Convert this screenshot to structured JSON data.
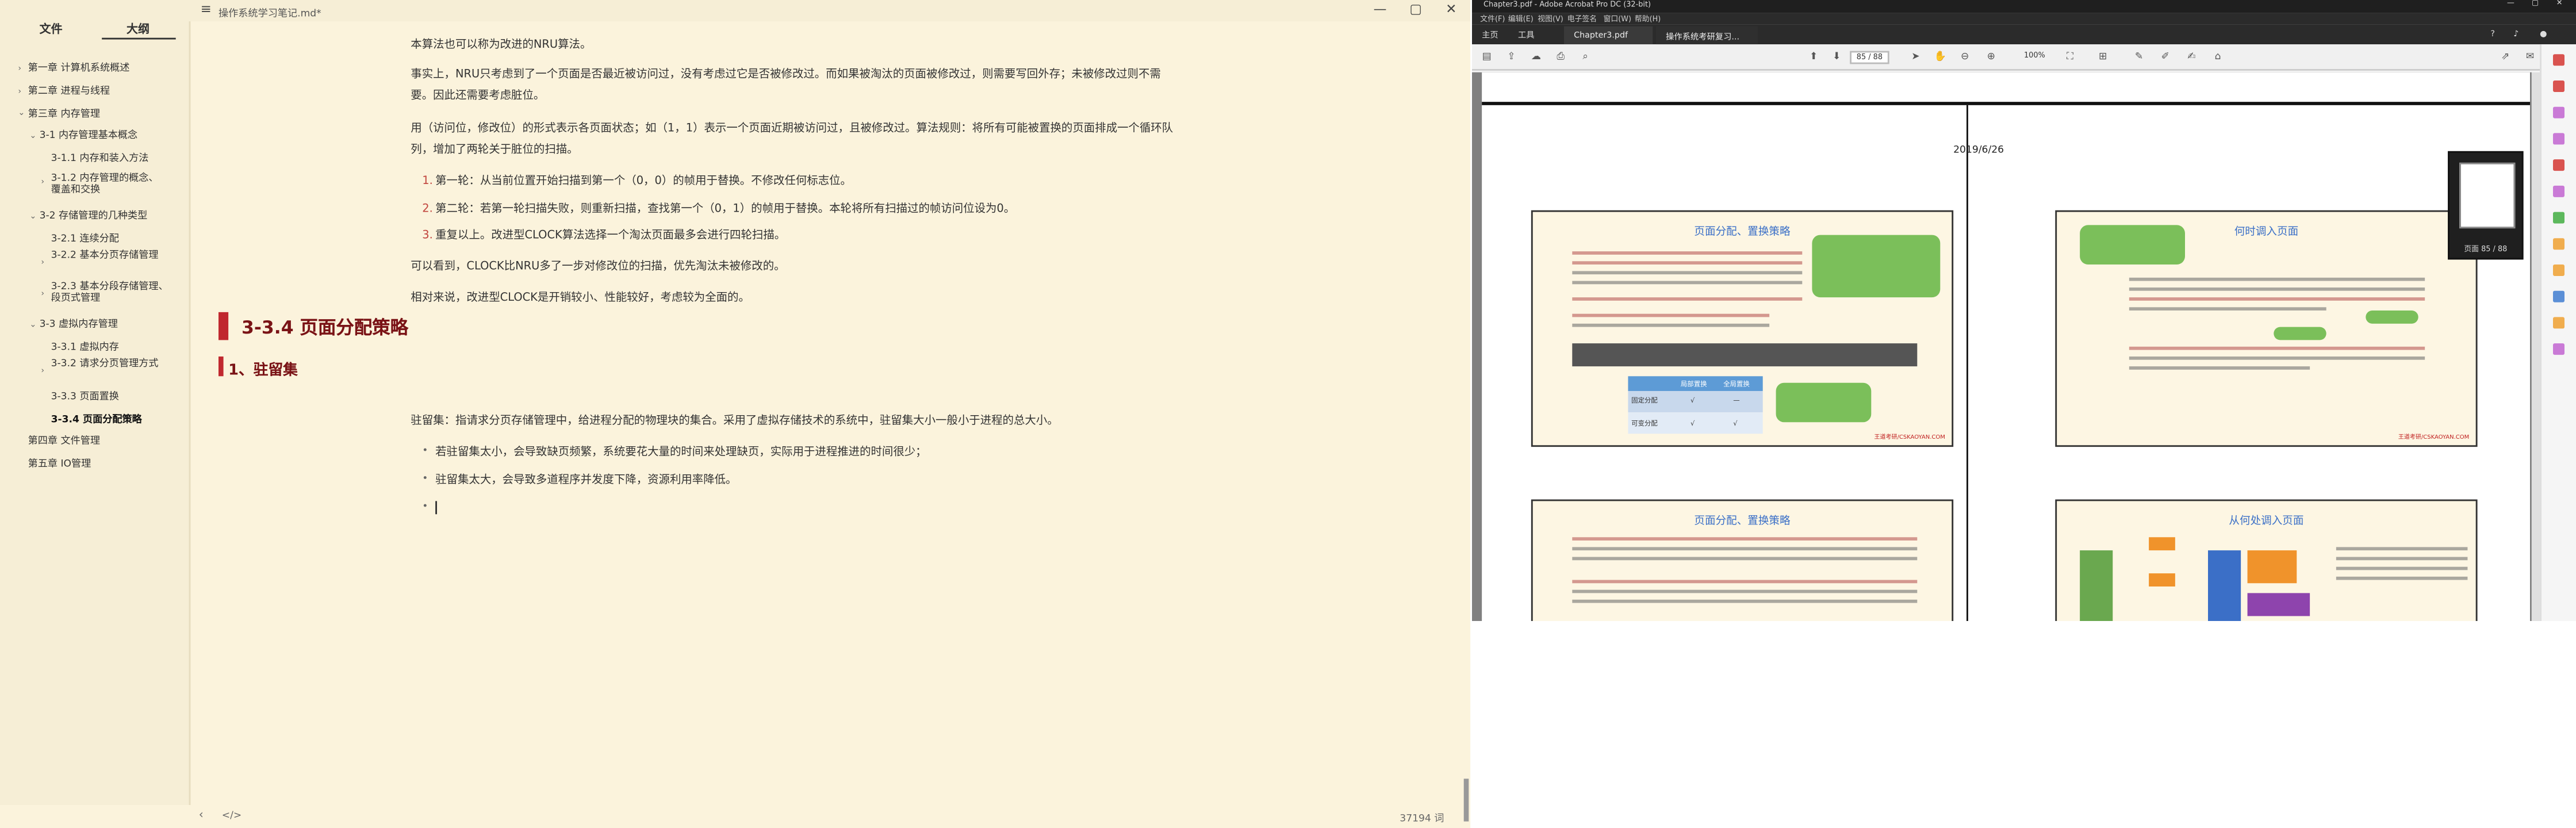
{
  "editor_window": {
    "title": "操作系统学习笔记.md*",
    "menu_icon": "hamburger-icon",
    "controls": {
      "minimize": "—",
      "maximize": "▢",
      "close": "✕"
    }
  },
  "sidebar": {
    "tabs": [
      "文件",
      "大纲"
    ],
    "active_tab": "大纲",
    "outline": [
      {
        "toggle": "›",
        "label": "第一章 计算机系统概述"
      },
      {
        "toggle": "›",
        "label": "第二章 进程与线程"
      },
      {
        "toggle": "⌄",
        "label": "第三章 内存管理"
      },
      {
        "toggle": "⌄",
        "label": "3-1 内存管理基本概念"
      },
      {
        "toggle": "",
        "label": "3-1.1 内存和装入方法"
      },
      {
        "toggle": "›",
        "label": "3-1.2 内存管理的概念、覆盖和交换"
      },
      {
        "toggle": "⌄",
        "label": "3-2 存储管理的几种类型"
      },
      {
        "toggle": "",
        "label": "3-2.1 连续分配"
      },
      {
        "toggle": "›",
        "label": "3-2.2 基本分页存储管理"
      },
      {
        "toggle": "›",
        "label": "3-2.3 基本分段存储管理、段页式管理"
      },
      {
        "toggle": "⌄",
        "label": "3-3 虚拟内存管理"
      },
      {
        "toggle": "",
        "label": "3-3.1 虚拟内存"
      },
      {
        "toggle": "›",
        "label": "3-3.2 请求分页管理方式"
      },
      {
        "toggle": "",
        "label": "3-3.3 页面置换"
      },
      {
        "toggle": "",
        "label": "3-3.4 页面分配策略"
      },
      {
        "toggle": "",
        "label": "第四章 文件管理"
      },
      {
        "toggle": "",
        "label": "第五章 IO管理"
      }
    ]
  },
  "content": {
    "p1": "本算法也可以称为改进的NRU算法。",
    "p2a": "事实上，NRU只考虑到了一个页面是否最近被访问过，没有考虑过它是否被修改过。而如果被淘汰的页面被修改过，则需要写回外存；未被修改过则不需",
    "p2b": "要。因此还需要考虑脏位。",
    "p3a": "用（访问位，修改位）的形式表示各页面状态；如（1，1）表示一个页面近期被访问过，且被修改过。算法规则：将所有可能被置换的页面排成一个循环队",
    "p3b": "列，增加了两轮关于脏位的扫描。",
    "steps": [
      {
        "num": "1.",
        "text": "第一轮：从当前位置开始扫描到第一个（0，0）的帧用于替换。不修改任何标志位。"
      },
      {
        "num": "2.",
        "text": "第二轮：若第一轮扫描失败，则重新扫描，查找第一个（0，1）的帧用于替换。本轮将所有扫描过的帧访问位设为0。"
      },
      {
        "num": "3.",
        "text": "重复以上。改进型CLOCK算法选择一个淘汰页面最多会进行四轮扫描。"
      }
    ],
    "p4": "可以看到，CLOCK比NRU多了一步对修改位的扫描，优先淘汰未被修改的。",
    "p5": "相对来说，改进型CLOCK是开销较小、性能较好，考虑较为全面的。",
    "heading2": "3-3.4 页面分配策略",
    "heading3": "1、驻留集",
    "p6": "驻留集：指请求分页存储管理中，给进程分配的物理块的集合。采用了虚拟存储技术的系统中，驻留集大小一般小于进程的总大小。",
    "bullets": [
      "若驻留集太小，会导致缺页频繁，系统要花大量的时间来处理缺页，实际用于进程推进的时间很少；",
      "驻留集太大，会导致多道程序并发度下降，资源利用率降低。",
      ""
    ]
  },
  "statusbar": {
    "left_icon": "chevron-left-icon",
    "code_icon": "</>",
    "word_count": "37194 词"
  },
  "acrobat": {
    "title": "Chapter3.pdf - Adobe Acrobat Pro DC (32-bit)",
    "menu": [
      "文件(F)",
      "编辑(E)",
      "视图(V)",
      "电子签名",
      "窗口(W)",
      "帮助(H)"
    ],
    "tabs": [
      "主页",
      "工具"
    ],
    "file_tabs": [
      "Chapter3.pdf",
      "操作系统考研复习..."
    ],
    "page_field": "85 / 88",
    "zoom": "100%",
    "pdf": {
      "date": "2019/6/26",
      "slides": [
        {
          "title": "页面分配、置换策略",
          "copyright": "王道考研/CSKAOYAN.COM",
          "table_header": [
            "局部置换",
            "全局置换"
          ],
          "table_rows": [
            [
              "固定分配",
              "√",
              "—"
            ],
            [
              "可变分配",
              "√",
              "√"
            ]
          ]
        },
        {
          "title": "何时调入页面",
          "copyright": "王道考研/CSKAOYAN.COM"
        },
        {
          "title": "页面分配、置换策略",
          "copyright": ""
        },
        {
          "title": "从何处调入页面",
          "copyright": ""
        }
      ]
    },
    "thumbnail_label": "页面 85 / 88"
  },
  "colors": {
    "editor_bg": "#fbf3dc",
    "heading_accent": "#c0282f",
    "list_number": "#c1443d",
    "acrobat_dark": "#2b2b2b"
  }
}
